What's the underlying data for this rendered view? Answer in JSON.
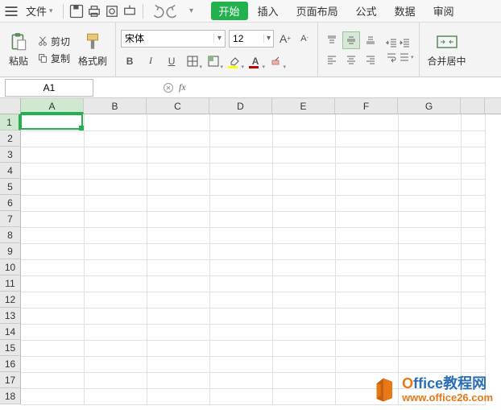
{
  "menubar": {
    "file_label": "文件",
    "tabs": [
      "开始",
      "插入",
      "页面布局",
      "公式",
      "数据",
      "审阅"
    ],
    "active_tab_index": 0
  },
  "clipboard": {
    "paste_label": "粘贴",
    "cut_label": "剪切",
    "copy_label": "复制",
    "format_painter_label": "格式刷"
  },
  "font": {
    "name": "宋体",
    "size": "12",
    "bold": "B",
    "italic": "I",
    "underline": "U",
    "font_color": "#c00000",
    "fill_color": "#ffff00"
  },
  "merge": {
    "label": "合并居中"
  },
  "namebox": {
    "value": "A1"
  },
  "formula": {
    "value": ""
  },
  "grid": {
    "columns": [
      "A",
      "B",
      "C",
      "D",
      "E",
      "F",
      "G"
    ],
    "rows": [
      "1",
      "2",
      "3",
      "4",
      "5",
      "6",
      "7",
      "8",
      "9",
      "10",
      "11",
      "12",
      "13",
      "14",
      "15",
      "16",
      "17",
      "18"
    ],
    "selected_col": 0,
    "selected_row": 0
  },
  "watermark": {
    "title_prefix": "O",
    "title_rest": "ffice教程网",
    "url": "www.office26.com"
  }
}
